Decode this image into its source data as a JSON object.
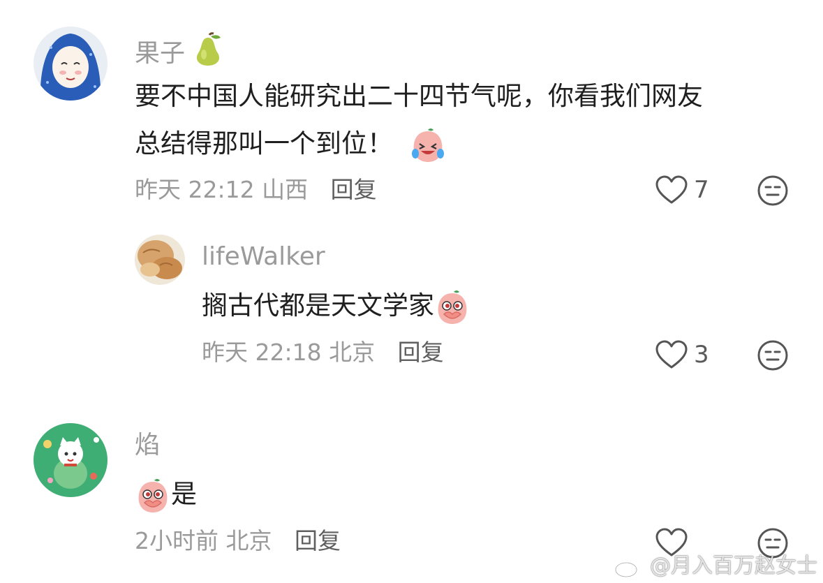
{
  "comments": [
    {
      "username": "果子",
      "username_badge_icon": "pear-icon",
      "text_line1": "要不中国人能研究出二十四节气呢，你看我们网友",
      "text_line2": "总结得那叫一个到位！",
      "text_emoji": "laughing-tears-peach-emoji",
      "time": "昨天 22:12",
      "location": "山西",
      "reply_label": "回复",
      "like_count": "7",
      "replies": [
        {
          "username": "lifeWalker",
          "text": "搁古代都是天文学家",
          "text_emoji": "covering-mouth-peach-emoji",
          "time": "昨天 22:18",
          "location": "北京",
          "reply_label": "回复",
          "like_count": "3"
        }
      ]
    },
    {
      "username": "焰",
      "text_emoji": "covering-mouth-peach-emoji",
      "text": "是",
      "time": "2小时前",
      "location": "北京",
      "reply_label": "回复",
      "like_count": ""
    }
  ],
  "watermark": {
    "text": "@月入百万赵女士",
    "icon": "weibo-logo-icon"
  },
  "colors": {
    "meta_gray": "#9a9a9a",
    "text_dark": "#1f1f1f",
    "icon_gray": "#555555"
  }
}
